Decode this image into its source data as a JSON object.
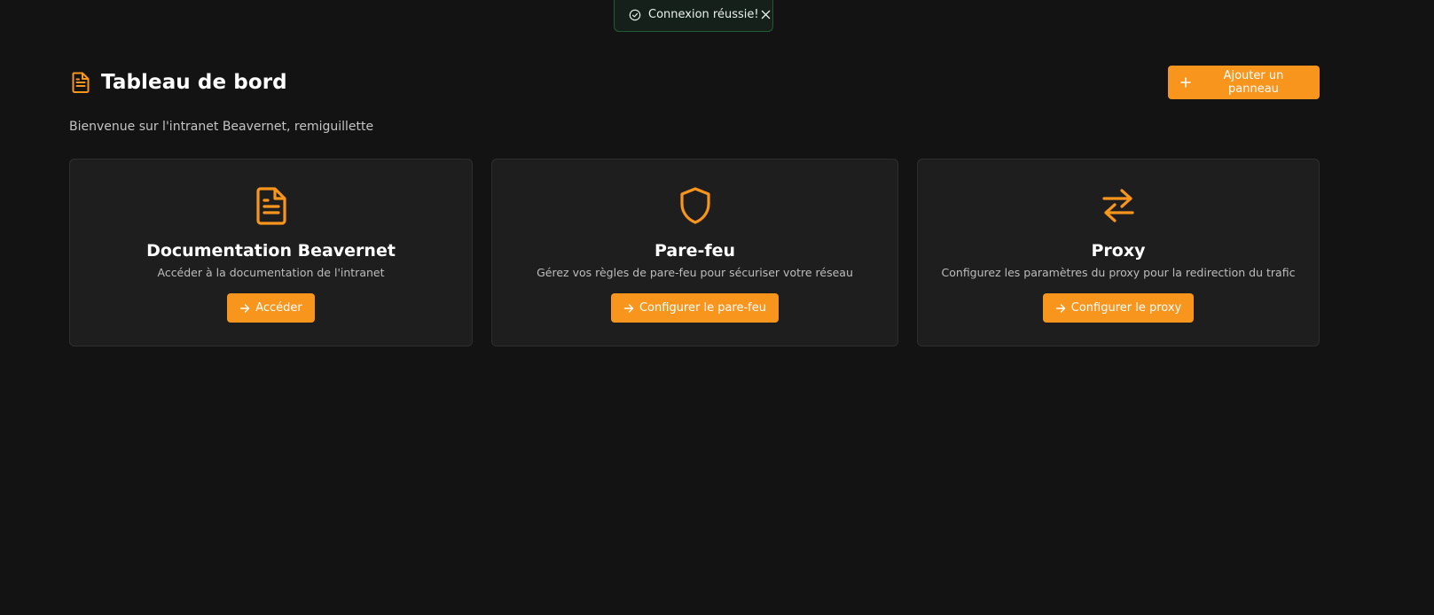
{
  "toast": {
    "message": "Connexion réussie!",
    "icon": "check-circle-icon",
    "close_icon": "close-icon"
  },
  "header": {
    "title": "Tableau de bord",
    "title_icon": "document-icon",
    "add_button_label": "Ajouter un panneau",
    "add_button_icon": "plus-icon"
  },
  "welcome": "Bienvenue sur l'intranet Beavernet, remiguillette",
  "cards": [
    {
      "icon": "document-icon",
      "title": "Documentation Beavernet",
      "description": "Accéder à la documentation de l'intranet",
      "button_label": "Accéder"
    },
    {
      "icon": "shield-icon",
      "title": "Pare-feu",
      "description": "Gérez vos règles de pare-feu pour sécuriser votre réseau",
      "button_label": "Configurer le pare-feu"
    },
    {
      "icon": "arrows-left-right-icon",
      "title": "Proxy",
      "description": "Configurez les paramètres du proxy pour la redirection du trafic",
      "button_label": "Configurer le proxy"
    }
  ],
  "colors": {
    "accent": "#f7951d",
    "background": "#131313",
    "card": "#1e1e1e",
    "toast_bg": "#15201a",
    "toast_border": "#1f5a35"
  }
}
